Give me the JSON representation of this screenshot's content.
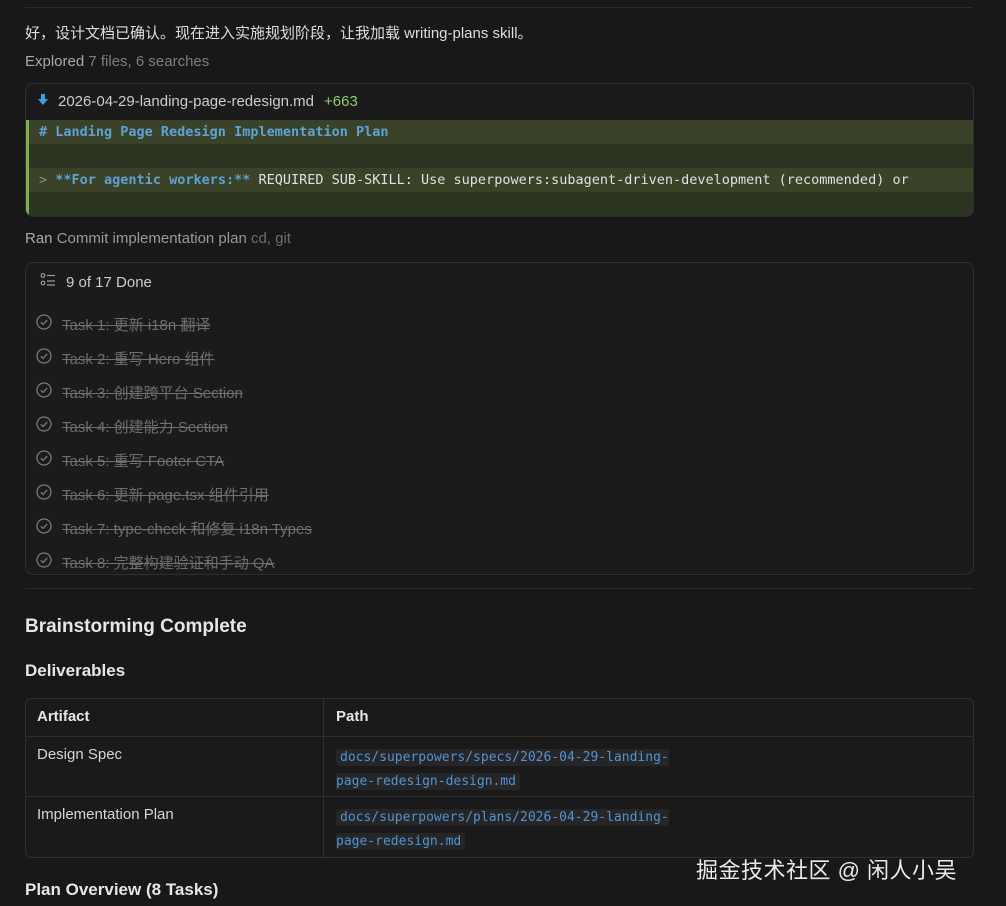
{
  "intro_text": "好，设计文档已确认。现在进入实施规划阶段，让我加载 writing-plans skill。",
  "explored": {
    "verb": "Explored",
    "detail": "7 files, 6 searches"
  },
  "diff": {
    "icon": "download-arrow-icon",
    "filename": "2026-04-29-landing-page-redesign.md",
    "added": "+663",
    "line1": "# Landing Page Redesign Implementation Plan",
    "line2_quote": ">",
    "line2_bold": "**For agentic workers:**",
    "line2_rest": " REQUIRED SUB-SKILL: Use superpowers:subagent-driven-development (recommended) or"
  },
  "ran": {
    "verb": "Ran",
    "desc": "Commit implementation plan",
    "detail": "cd, git"
  },
  "todo": {
    "status": "9 of 17 Done",
    "items": [
      "Task 1: 更新 i18n 翻译",
      "Task 2: 重写 Hero 组件",
      "Task 3: 创建跨平台 Section",
      "Task 4: 创建能力 Section",
      "Task 5: 重写 Footer CTA",
      "Task 6: 更新 page.tsx 组件引用",
      "Task 7: type-check 和修复 i18n Types",
      "Task 8: 完整构建验证和手动 QA"
    ]
  },
  "heading_complete": "Brainstorming Complete",
  "heading_deliverables": "Deliverables",
  "table": {
    "col_artifact": "Artifact",
    "col_path": "Path",
    "rows": [
      {
        "artifact": "Design Spec",
        "path": "docs/superpowers/specs/2026-04-29-landing-page-redesign-design.md"
      },
      {
        "artifact": "Implementation Plan",
        "path": "docs/superpowers/plans/2026-04-29-landing-page-redesign.md"
      }
    ]
  },
  "heading_overview": "Plan Overview (8 Tasks)",
  "watermark": "掘金技术社区 @ 闲人小吴",
  "colors": {
    "background": "#181818",
    "diff_added": "#8ccf6e",
    "code_link": "#4e94d6",
    "diff_highlight": "#3a4228"
  }
}
